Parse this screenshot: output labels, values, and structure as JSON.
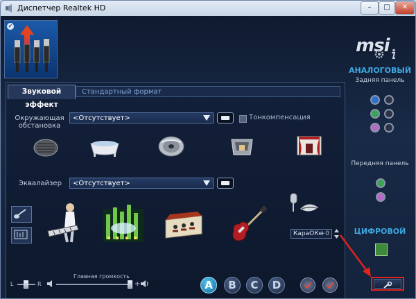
{
  "window": {
    "title": "Диспетчер Realtek HD",
    "controls": {
      "minimize": "–",
      "maximize": "□",
      "close": "✕"
    }
  },
  "brand": {
    "logo": "msi"
  },
  "tabs": {
    "active": "Звуковой эффект",
    "format": "Стандартный формат"
  },
  "environment": {
    "label": "Окружающая обстановка",
    "value": "<Отсутствует>",
    "loudness_label": "Тонкомпенсация",
    "presets": [
      "sewer-grate",
      "bathtub",
      "cd-disc",
      "stone-room",
      "theater"
    ]
  },
  "equalizer": {
    "label": "Эквалайзер",
    "value": "<Отсутствует>",
    "presets": [
      "keyboard-singer",
      "club",
      "stage-party",
      "electric-guitar",
      "microphone-lips"
    ]
  },
  "karaoke": {
    "label": "КараОКе",
    "value": "+0"
  },
  "volume": {
    "title": "Главная громкость",
    "left": "L",
    "right": "R",
    "plus": "+"
  },
  "profiles": [
    "A",
    "B",
    "C",
    "D"
  ],
  "side": {
    "analog_title": "АНАЛОГОВЫЙ",
    "rear_panel": "Задняя панель",
    "front_panel": "Передняя панель",
    "digital_title": "ЦИФРОВОЙ"
  },
  "colors": {
    "jack_blue": "#2d6fd0",
    "jack_green": "#3aa456",
    "jack_pink": "#b56ac6",
    "accent": "#3ea7e0"
  }
}
